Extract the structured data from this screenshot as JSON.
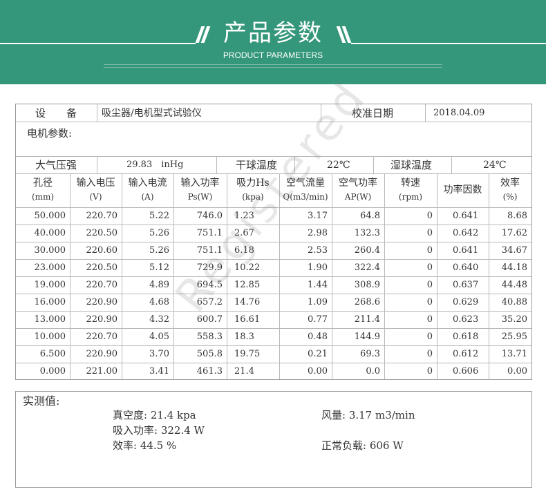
{
  "banner": {
    "title": "产品参数",
    "subtitle": "PRODUCT PARAMETERS"
  },
  "info": {
    "device_label": "设　　备",
    "device_value": "吸尘器/电机型式试验仪",
    "calib_label": "校准日期",
    "calib_value": "2018.04.09",
    "motor_params_label": "电机参数:",
    "pressure_label": "大气压强",
    "pressure_value": "29.83　inHg",
    "dry_label": "干球温度",
    "dry_value": "22℃",
    "wet_label": "湿球温度",
    "wet_value": "24℃"
  },
  "table": {
    "headers": [
      [
        "孔径",
        "(mm)"
      ],
      [
        "输入电压",
        "(V)"
      ],
      [
        "输入电流",
        "(A)"
      ],
      [
        "输入功率",
        "Ps(W)"
      ],
      [
        "吸力Hs",
        "(kpa)"
      ],
      [
        "空气流量",
        "Q(m3/min)"
      ],
      [
        "空气功率",
        "AP(W)"
      ],
      [
        "转速",
        "(rpm)"
      ],
      [
        "功率因数",
        ""
      ],
      [
        "效率",
        "(%)"
      ]
    ],
    "rows": [
      [
        "50.000",
        "220.70",
        "5.22",
        "746.0",
        "1.23",
        "3.17",
        "64.8",
        "0",
        "0.641",
        "8.68"
      ],
      [
        "40.000",
        "220.50",
        "5.26",
        "751.1",
        "2.67",
        "2.98",
        "132.3",
        "0",
        "0.642",
        "17.62"
      ],
      [
        "30.000",
        "220.60",
        "5.26",
        "751.1",
        "6.18",
        "2.53",
        "260.4",
        "0",
        "0.641",
        "34.67"
      ],
      [
        "23.000",
        "220.50",
        "5.12",
        "729.9",
        "10.22",
        "1.90",
        "322.4",
        "0",
        "0.640",
        "44.18"
      ],
      [
        "19.000",
        "220.70",
        "4.89",
        "694.5",
        "12.85",
        "1.44",
        "308.9",
        "0",
        "0.637",
        "44.48"
      ],
      [
        "16.000",
        "220.90",
        "4.68",
        "657.2",
        "14.76",
        "1.09",
        "268.6",
        "0",
        "0.629",
        "40.88"
      ],
      [
        "13.000",
        "220.90",
        "4.32",
        "600.7",
        "16.61",
        "0.77",
        "211.4",
        "0",
        "0.623",
        "35.20"
      ],
      [
        "10.000",
        "220.70",
        "4.05",
        "558.3",
        "18.3",
        "0.48",
        "144.9",
        "0",
        "0.618",
        "25.95"
      ],
      [
        "6.500",
        "220.90",
        "3.70",
        "505.8",
        "19.75",
        "0.21",
        "69.3",
        "0",
        "0.612",
        "13.71"
      ],
      [
        "0.000",
        "221.00",
        "3.41",
        "461.3",
        "21.4",
        "0.00",
        "0.0",
        "0",
        "0.606",
        "0.00"
      ]
    ]
  },
  "measured": {
    "title": "实测值:",
    "vacuum": "真空度: 21.4 kpa",
    "airflow": "风量: 3.17 m3/min",
    "input_power": "吸入功率: 322.4 W",
    "efficiency": "效率: 44.5 %",
    "normal_load": "正常负载: 606 W"
  },
  "watermark": "Registered"
}
